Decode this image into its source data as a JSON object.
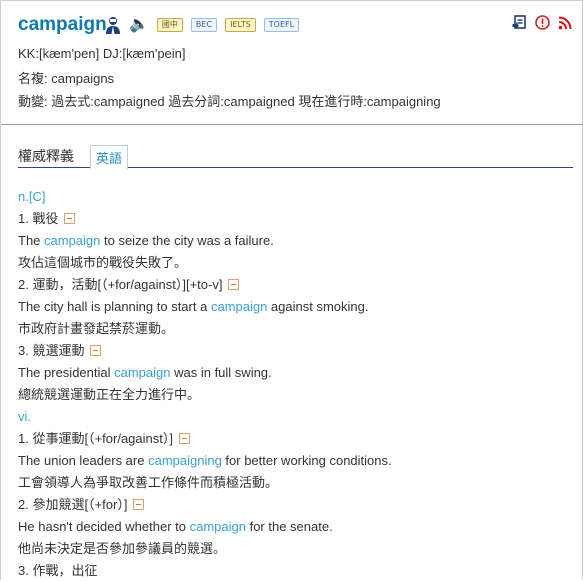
{
  "header": {
    "word": "campaign",
    "icons": {
      "person": "person-icon",
      "speaker": "speaker-icon",
      "report": "report-icon",
      "alert": "alert-icon",
      "rss": "rss-icon"
    },
    "badges": [
      "國中",
      "BEC",
      "IELTS",
      "TOEFL"
    ],
    "pronunciation": "KK:[kæm'pen] DJ:[kæm'pein]",
    "plural": "名複: campaigns",
    "verb_forms": "動變: 過去式:campaigned  過去分詞:campaigned  現在進行時:campaigning"
  },
  "tabs": {
    "active": "權威釋義",
    "english": "英語"
  },
  "entries": [
    {
      "type": "pos",
      "text": "n.[C]"
    },
    {
      "type": "sense",
      "text": "1. 戰役"
    },
    {
      "type": "example",
      "before": "The ",
      "hl": "campaign",
      "after": " to seize the city was a failure."
    },
    {
      "type": "translation",
      "text": "攻佔這個城市的戰役失敗了。"
    },
    {
      "type": "sense",
      "text": "2. 運動，活動[（+for/against）][+to-v]"
    },
    {
      "type": "example",
      "before": "The city hall is planning to start a ",
      "hl": "campaign",
      "after": " against smoking."
    },
    {
      "type": "translation",
      "text": "市政府計畫發起禁菸運動。"
    },
    {
      "type": "sense",
      "text": "3. 競選運動"
    },
    {
      "type": "example",
      "before": "The presidential ",
      "hl": "campaign",
      "after": " was in full swing."
    },
    {
      "type": "translation",
      "text": "總統競選運動正在全力進行中。"
    },
    {
      "type": "pos",
      "text": "vi."
    },
    {
      "type": "sense",
      "text": "1. 從事運動[（+for/against）]"
    },
    {
      "type": "example",
      "before": "The union leaders are ",
      "hl": "campaigning",
      "after": " for better working conditions."
    },
    {
      "type": "translation",
      "text": "工會領導人為爭取改善工作條件而積極活動。"
    },
    {
      "type": "sense",
      "text": "2. 參加競選[（+for）]"
    },
    {
      "type": "example",
      "before": "He hasn't decided whether to ",
      "hl": "campaign",
      "after": " for the senate."
    },
    {
      "type": "translation",
      "text": "他尚未決定是否參加參議員的競選。"
    },
    {
      "type": "sense-nominus",
      "text": "3. 作戰，出征"
    }
  ],
  "colors": {
    "word": "#0e7aa9",
    "highlight": "#39a0d0",
    "tab_underline": "#2b4a7a"
  }
}
